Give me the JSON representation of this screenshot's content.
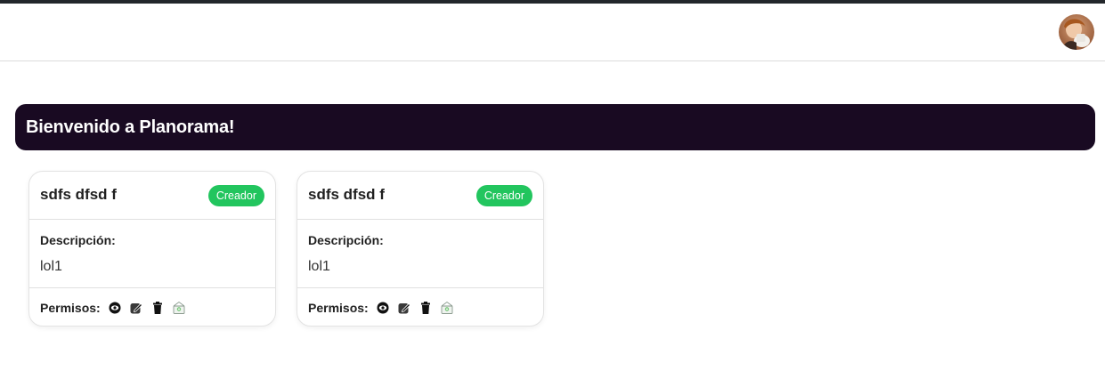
{
  "header": {
    "avatar_icon": "user-avatar-photo"
  },
  "banner": {
    "title": "Bienvenido a Planorama!"
  },
  "cards": [
    {
      "title": "sdfs dfsd f",
      "badge": "Creador",
      "description_label": "Descripción:",
      "description": "lol1",
      "permissions_label": "Permisos:",
      "permission_icons": [
        "eye-icon",
        "edit-icon",
        "trash-icon",
        "share-icon"
      ]
    },
    {
      "title": "sdfs dfsd f",
      "badge": "Creador",
      "description_label": "Descripción:",
      "description": "lol1",
      "permissions_label": "Permisos:",
      "permission_icons": [
        "eye-icon",
        "edit-icon",
        "trash-icon",
        "share-icon"
      ]
    }
  ],
  "colors": {
    "banner_bg": "#190a22",
    "badge_bg": "#22c55e",
    "top_strip": "#23272b"
  }
}
